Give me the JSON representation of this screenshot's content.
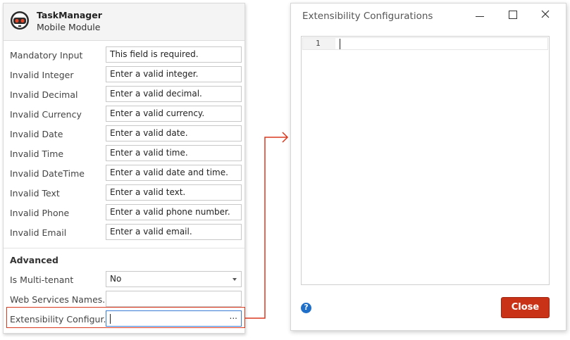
{
  "module": {
    "name": "TaskManager",
    "type": "Mobile Module"
  },
  "validation_messages": [
    {
      "label": "Mandatory Input",
      "value": "This field is required."
    },
    {
      "label": "Invalid Integer",
      "value": "Enter a valid integer."
    },
    {
      "label": "Invalid Decimal",
      "value": "Enter a valid decimal."
    },
    {
      "label": "Invalid Currency",
      "value": "Enter a valid currency."
    },
    {
      "label": "Invalid Date",
      "value": "Enter a valid date."
    },
    {
      "label": "Invalid Time",
      "value": "Enter a valid time."
    },
    {
      "label": "Invalid DateTime",
      "value": "Enter a valid date and time."
    },
    {
      "label": "Invalid Text",
      "value": "Enter a valid text."
    },
    {
      "label": "Invalid Phone",
      "value": "Enter a valid phone number."
    },
    {
      "label": "Invalid Email",
      "value": "Enter a valid email."
    }
  ],
  "advanced": {
    "section_title": "Advanced",
    "multi_tenant_label": "Is Multi-tenant",
    "multi_tenant_value": "No",
    "web_services_label": "Web Services Names...",
    "web_services_value": "",
    "extensibility_label": "Extensibility Configur...",
    "extensibility_value": "",
    "ellipsis": "..."
  },
  "dialog": {
    "title": "Extensibility Configurations",
    "line_number": "1",
    "help_label": "?",
    "close_label": "Close"
  },
  "colors": {
    "accent_red": "#c93216",
    "highlight_red": "#d9391e",
    "help_blue": "#1f6fc9"
  },
  "icons": {
    "module": "robot-helmet-icon",
    "minimize": "minimize-icon",
    "maximize": "maximize-icon",
    "close": "close-icon",
    "help": "help-icon",
    "arrow": "arrow-right-icon"
  }
}
